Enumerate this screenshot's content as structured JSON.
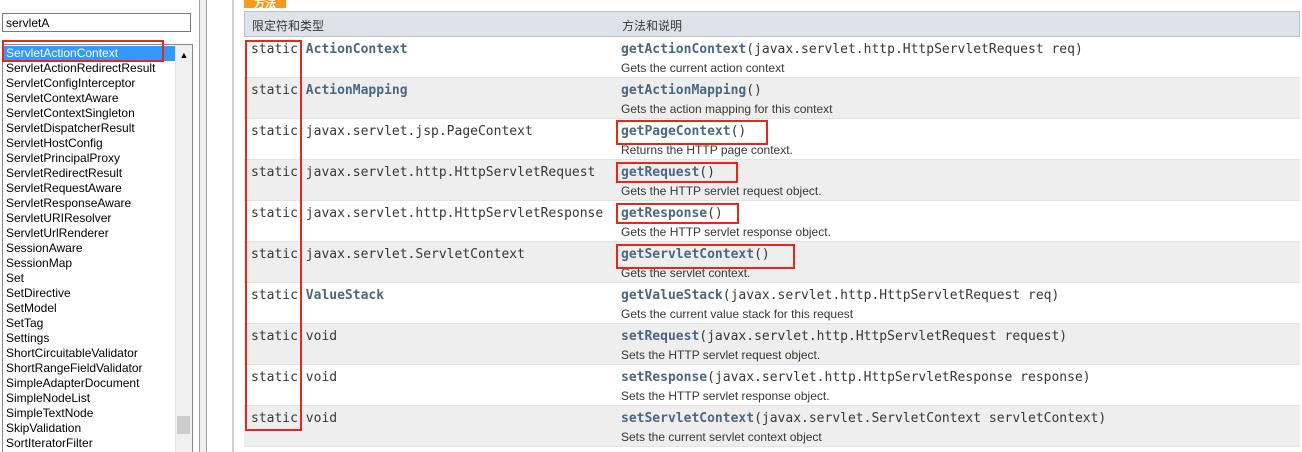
{
  "left": {
    "search_value": "servletA",
    "items": [
      "ServletActionContext",
      "ServletActionRedirectResult",
      "ServletConfigInterceptor",
      "ServletContextAware",
      "ServletContextSingleton",
      "ServletDispatcherResult",
      "ServletHostConfig",
      "ServletPrincipalProxy",
      "ServletRedirectResult",
      "ServletRequestAware",
      "ServletResponseAware",
      "ServletURIResolver",
      "ServletUrlRenderer",
      "SessionAware",
      "SessionMap",
      "Set",
      "SetDirective",
      "SetModel",
      "SetTag",
      "Settings",
      "ShortCircuitableValidator",
      "ShortRangeFieldValidator",
      "SimpleAdapterDocument",
      "SimpleNodeList",
      "SimpleTextNode",
      "SkipValidation",
      "SortIteratorFilter"
    ],
    "selected_index": 0,
    "scroll_up_glyph": "▲"
  },
  "section": {
    "tab_label": "方法"
  },
  "table": {
    "col_type": "限定符和类型",
    "col_method": "方法和说明",
    "rows": [
      {
        "mod": "static",
        "type": "ActionContext",
        "type_link": true,
        "method": "getActionContext",
        "params": "(javax.servlet.http.HttpServletRequest req)",
        "desc": "Gets the current action context"
      },
      {
        "mod": "static",
        "type": "ActionMapping",
        "type_link": true,
        "method": "getActionMapping",
        "params": "()",
        "desc": "Gets the action mapping for this context"
      },
      {
        "mod": "static",
        "type": "javax.servlet.jsp.PageContext",
        "type_link": false,
        "method": "getPageContext",
        "params": "()",
        "desc": "Returns the HTTP page context."
      },
      {
        "mod": "static",
        "type": "javax.servlet.http.HttpServletRequest",
        "type_link": false,
        "method": "getRequest",
        "params": "()",
        "desc": "Gets the HTTP servlet request object."
      },
      {
        "mod": "static",
        "type": "javax.servlet.http.HttpServletResponse",
        "type_link": false,
        "method": "getResponse",
        "params": "()",
        "desc": "Gets the HTTP servlet response object."
      },
      {
        "mod": "static",
        "type": "javax.servlet.ServletContext",
        "type_link": false,
        "method": "getServletContext",
        "params": "()",
        "desc": "Gets the servlet context."
      },
      {
        "mod": "static",
        "type": "ValueStack",
        "type_link": true,
        "method": "getValueStack",
        "params": "(javax.servlet.http.HttpServletRequest req)",
        "desc": "Gets the current value stack for this request"
      },
      {
        "mod": "static",
        "type": "void",
        "type_link": false,
        "method": "setRequest",
        "params": "(javax.servlet.http.HttpServletRequest request)",
        "desc": "Sets the HTTP servlet request object."
      },
      {
        "mod": "static",
        "type": "void",
        "type_link": false,
        "method": "setResponse",
        "params": "(javax.servlet.http.HttpServletResponse response)",
        "desc": "Sets the HTTP servlet response object."
      },
      {
        "mod": "static",
        "type": "void",
        "type_link": false,
        "method": "setServletContext",
        "params": "(javax.servlet.ServletContext servletContext)",
        "desc": "Sets the current servlet context object"
      }
    ]
  },
  "colors": {
    "highlight": "#e8261a",
    "selected_bg": "#3399ff",
    "link": "#4a6782",
    "tab": "#f8981d"
  }
}
